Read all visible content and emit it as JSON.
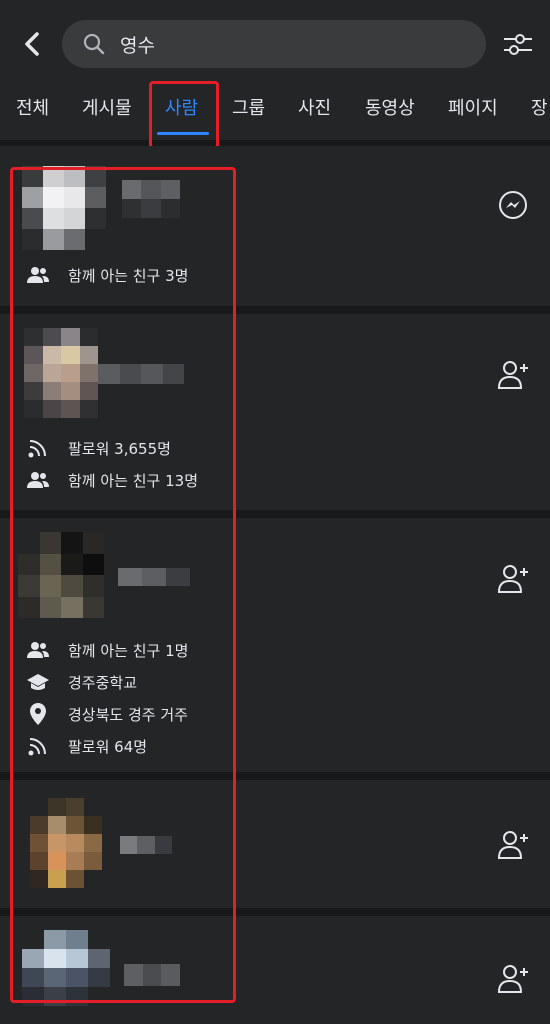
{
  "search": {
    "query": "영수"
  },
  "tabs": [
    "전체",
    "게시물",
    "사람",
    "그룹",
    "사진",
    "동영상",
    "페이지",
    "장"
  ],
  "active_tab": "사람",
  "results": [
    {
      "action": "messenger-icon",
      "info": [
        {
          "icon": "mutual-friends-icon",
          "text": "함께 아는 친구 3명"
        }
      ]
    },
    {
      "action": "add-friend-icon",
      "info": [
        {
          "icon": "follow-feed-icon",
          "text": "팔로워 3,655명"
        },
        {
          "icon": "mutual-friends-icon",
          "text": "함께 아는 친구 13명"
        }
      ]
    },
    {
      "action": "add-friend-icon",
      "info": [
        {
          "icon": "mutual-friends-icon",
          "text": "함께 아는 친구 1명"
        },
        {
          "icon": "graduation-cap-icon",
          "text": "경주중학교"
        },
        {
          "icon": "location-pin-icon",
          "text": "경상북도 경주 거주"
        },
        {
          "icon": "follow-feed-icon",
          "text": "팔로워 64명"
        }
      ]
    },
    {
      "action": "add-friend-icon",
      "info": []
    },
    {
      "action": "add-friend-icon",
      "info": []
    }
  ],
  "colors": {
    "accent": "#2d88ff",
    "highlight": "#e41e26",
    "card": "#242526",
    "background": "#18191a"
  }
}
